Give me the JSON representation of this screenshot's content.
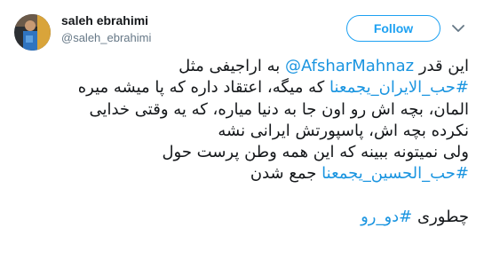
{
  "author": {
    "name": "saleh ebrahimi",
    "handle": "@saleh_ebrahimi"
  },
  "actions": {
    "follow_label": "Follow",
    "more_icon": "chevron-down-icon"
  },
  "colors": {
    "accent": "#1da1f2",
    "link": "#1b95e0",
    "text": "#14171a",
    "secondary": "#657786"
  },
  "tweet": {
    "line1": {
      "pre": "این قدر",
      "mention": "@AfsharMahnaz",
      "post": "به اراجیفی مثل"
    },
    "line2": {
      "hashtag": "#حب_الایران_یجمعنا",
      "post": "که میگه، اعتقاد داره که پا میشه میره"
    },
    "line3": "المان، بچه اش رو اون جا به دنیا میاره، که یه وقتی خدایی",
    "line4": "نکرده بچه اش، پاسپورتش ایرانی نشه",
    "line5": "ولی نمیتونه ببینه که این همه وطن پرست حول",
    "line6": {
      "hashtag": "#حب_الحسین_یجمعنا",
      "post": "جمع شدن"
    },
    "line7": {
      "pre": "چطوری",
      "hashtag": "#دو_رو"
    }
  }
}
